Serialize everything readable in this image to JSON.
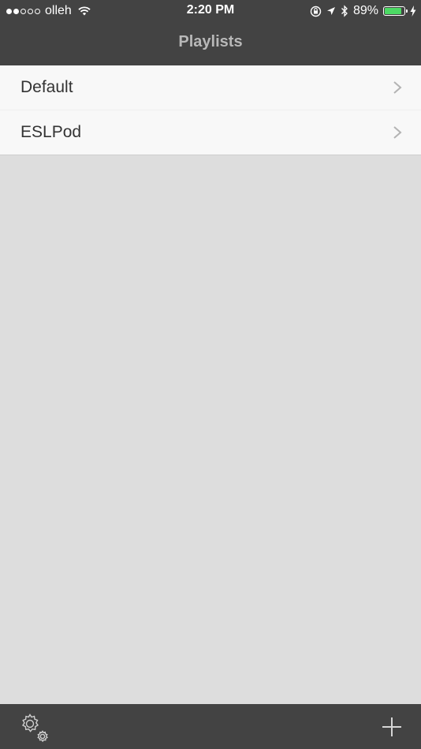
{
  "status_bar": {
    "carrier": "olleh",
    "signal_bars_filled": 2,
    "signal_bars_total": 5,
    "time": "2:20 PM",
    "battery_percent": "89%",
    "battery_level": 0.89,
    "icons": [
      "wifi-icon",
      "orientation-lock-icon",
      "location-arrow-icon",
      "bluetooth-icon",
      "battery-icon",
      "charging-bolt-icon"
    ]
  },
  "nav": {
    "title": "Playlists"
  },
  "playlists": [
    {
      "label": "Default"
    },
    {
      "label": "ESLPod"
    }
  ],
  "toolbar": {
    "settings_icon": "settings-gears-icon",
    "add_icon": "plus-icon"
  },
  "colors": {
    "bar_background": "#434343",
    "list_background": "#f8f8f8",
    "page_background": "#dddddd",
    "battery_fill": "#4cd964",
    "title_color": "#b8b8b8"
  }
}
